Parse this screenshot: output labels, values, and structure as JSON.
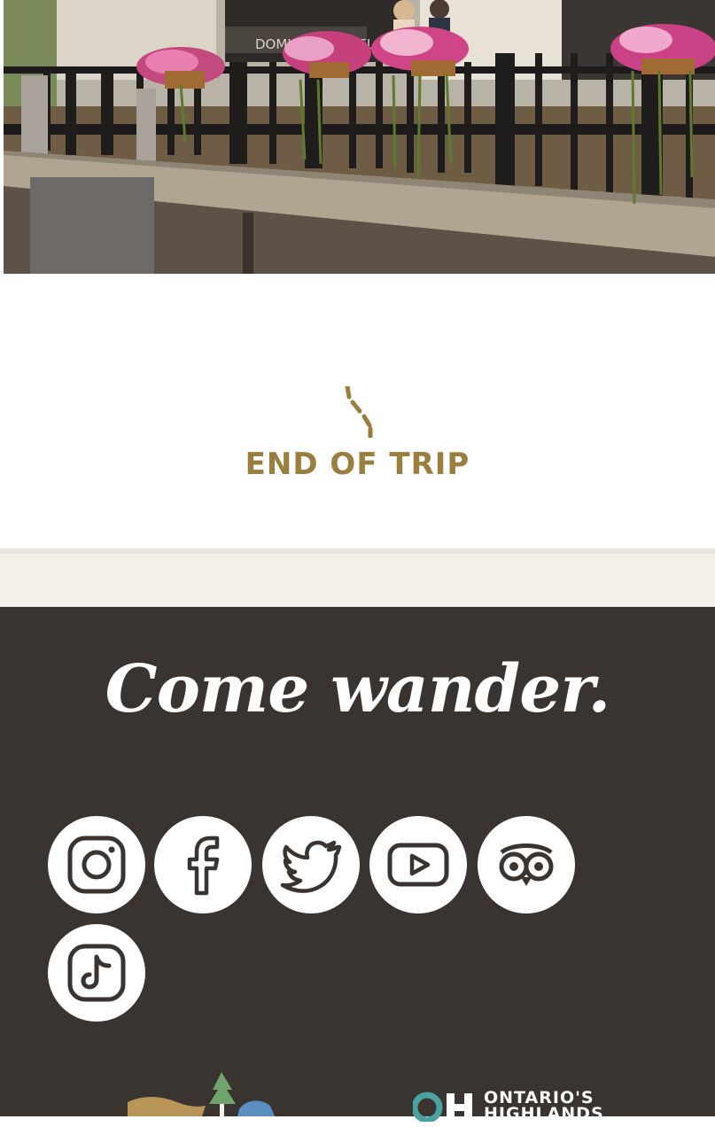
{
  "hero": {
    "storefront_sign": "DOMINION HOTEL"
  },
  "end_section": {
    "title": "END OF TRIP"
  },
  "footer": {
    "tagline": "Come wander.",
    "social": [
      {
        "name": "instagram"
      },
      {
        "name": "facebook"
      },
      {
        "name": "twitter"
      },
      {
        "name": "youtube"
      },
      {
        "name": "tripadvisor"
      },
      {
        "name": "tiktok"
      }
    ],
    "partner_logo_text": "ONTARIO'S HIGHLANDS"
  },
  "colors": {
    "accent_gold": "#9a7e3e",
    "footer_bg": "#3a3430",
    "band_bg": "#f5f1e8"
  }
}
